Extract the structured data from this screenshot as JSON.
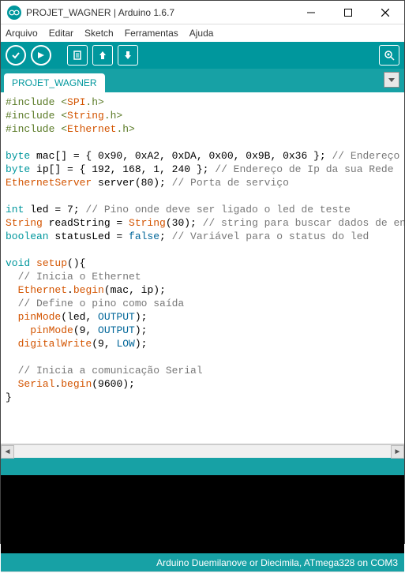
{
  "window": {
    "title": "PROJET_WAGNER | Arduino 1.6.7"
  },
  "menu": {
    "arquivo": "Arquivo",
    "editar": "Editar",
    "sketch": "Sketch",
    "ferramentas": "Ferramentas",
    "ajuda": "Ajuda"
  },
  "tabs": {
    "main": "PROJET_WAGNER"
  },
  "code": {
    "l1a": "#include <",
    "l1b": "SPI",
    "l1c": ".h>",
    "l2a": "#include <",
    "l2b": "String",
    "l2c": ".h>",
    "l3a": "#include <",
    "l3b": "Ethernet",
    "l3c": ".h>",
    "l5a": "byte",
    "l5b": " mac[] = { 0x90, 0xA2, 0xDA, 0x00, 0x9B, 0x36 }; ",
    "l5c": "// Endereço Mac",
    "l6a": "byte",
    "l6b": " ip[] = { 192, 168, 1, 240 }; ",
    "l6c": "// Endereço de Ip da sua Rede",
    "l7a": "EthernetServer",
    "l7b": " server(80); ",
    "l7c": "// Porta de serviço",
    "l9a": "int",
    "l9b": " led = 7; ",
    "l9c": "// Pino onde deve ser ligado o led de teste",
    "l10a": "String",
    "l10b": " readString = ",
    "l10c": "String",
    "l10d": "(30); ",
    "l10e": "// string para buscar dados de endereço",
    "l11a": "boolean",
    "l11b": " statusLed = ",
    "l11c": "false",
    "l11d": "; ",
    "l11e": "// Variável para o status do led",
    "l13a": "void",
    "l13b": " ",
    "l13c": "setup",
    "l13d": "(){",
    "l14": "  // Inicia o Ethernet",
    "l15a": "  ",
    "l15b": "Ethernet",
    "l15c": ".",
    "l15d": "begin",
    "l15e": "(mac, ip);",
    "l16": "  // Define o pino como saída",
    "l17a": "  ",
    "l17b": "pinMode",
    "l17c": "(led, ",
    "l17d": "OUTPUT",
    "l17e": ");",
    "l18a": "    ",
    "l18b": "pinMode",
    "l18c": "(9, ",
    "l18d": "OUTPUT",
    "l18e": ");",
    "l19a": "  ",
    "l19b": "digitalWrite",
    "l19c": "(9, ",
    "l19d": "LOW",
    "l19e": ");",
    "l21": "  // Inicia a comunicação Serial",
    "l22a": "  ",
    "l22b": "Serial",
    "l22c": ".",
    "l22d": "begin",
    "l22e": "(9600);",
    "l23": "}"
  },
  "status": {
    "board": "Arduino Duemilanove or Diecimila, ATmega328 on COM3"
  }
}
